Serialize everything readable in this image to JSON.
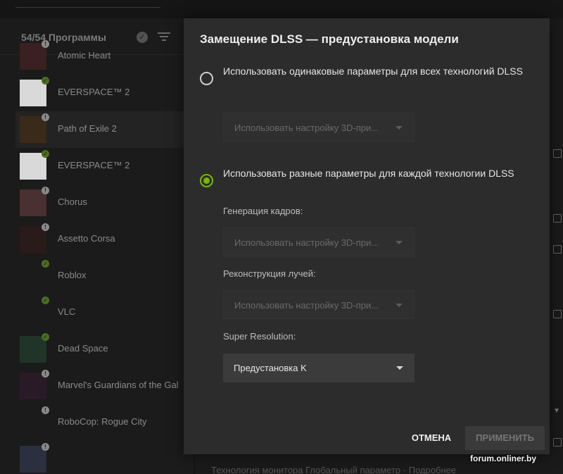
{
  "sidebar": {
    "count_label": "54/54 Программы",
    "games": [
      {
        "name": "Atomic Heart",
        "status": "warn",
        "selected": false,
        "thumb_color": "#3a2020"
      },
      {
        "name": "EVERSPACE™ 2",
        "status": "ok",
        "selected": false,
        "thumb_color": "#d9d9d9"
      },
      {
        "name": "Path of Exile 2",
        "status": "warn",
        "selected": true,
        "thumb_color": "#3a2a1a"
      },
      {
        "name": "EVERSPACE™ 2",
        "status": "ok",
        "selected": false,
        "thumb_color": "#d9d9d9"
      },
      {
        "name": "Chorus",
        "status": "warn",
        "selected": false,
        "thumb_color": "#4a3030"
      },
      {
        "name": "Assetto Corsa",
        "status": "warn",
        "selected": false,
        "thumb_color": "#2a1a1a"
      },
      {
        "name": "Roblox",
        "status": "ok",
        "selected": false,
        "thumb_color": "#1b1b1b"
      },
      {
        "name": "VLC",
        "status": "ok",
        "selected": false,
        "thumb_color": "#1b1b1b"
      },
      {
        "name": "Dead Space",
        "status": "ok",
        "selected": false,
        "thumb_color": "#203428"
      },
      {
        "name": "Marvel's Guardians of the Gal",
        "status": "warn",
        "selected": false,
        "thumb_color": "#2a1a28"
      },
      {
        "name": "RoboCop: Rogue City",
        "status": "warn",
        "selected": false,
        "thumb_color": "#1b1b1b"
      },
      {
        "name": "",
        "status": "warn",
        "selected": false,
        "thumb_color": "#2a3040"
      }
    ]
  },
  "dialog": {
    "title": "Замещение DLSS — предустановка модели",
    "option_same": "Использовать одинаковые параметры для всех технологий DLSS",
    "option_same_select": "Использовать настройку 3D-при...",
    "option_different": "Использовать разные параметры для каждой технологии DLSS",
    "frame_gen_label": "Генерация кадров:",
    "frame_gen_select": "Использовать настройку 3D-при...",
    "ray_recon_label": "Реконструкция лучей:",
    "ray_recon_select": "Использовать настройку 3D-при...",
    "super_res_label": "Super Resolution:",
    "super_res_select": "Предустановка K",
    "cancel_label": "ОТМЕНА",
    "apply_label": "ПРИМЕНИТЬ",
    "selected_option": "different"
  },
  "background": {
    "bottom_text": "Технология монитора      Глобальный параметр · Подробнее"
  },
  "watermark": "forum.onliner.by",
  "colors": {
    "accent": "#76b900",
    "dialog_bg": "#2c2c2c",
    "sidebar_bg": "#1b1b1b"
  }
}
